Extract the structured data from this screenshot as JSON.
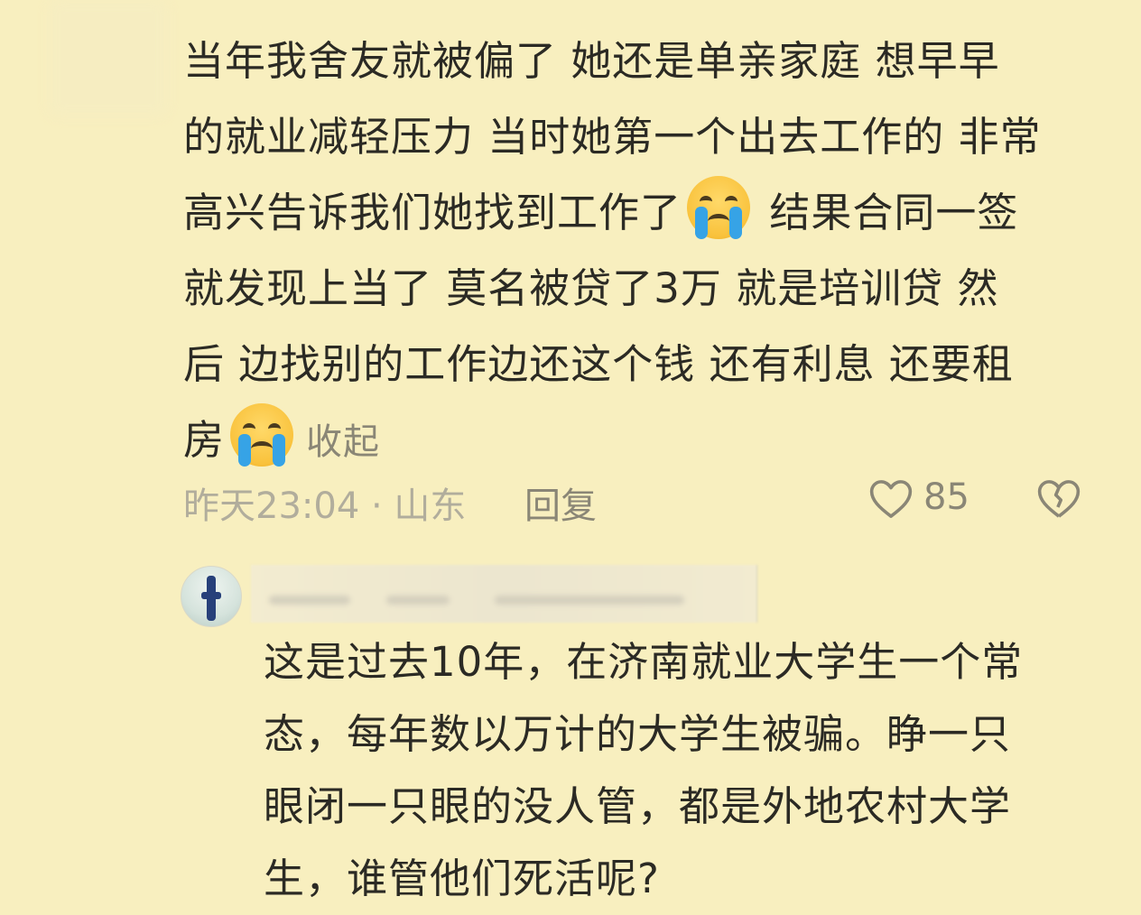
{
  "comment": {
    "lines": [
      "当年我舍友就被偏了  她还是单亲家庭 想早早",
      "的就业减轻压力 当时她第一个出去工作的 非常",
      "高兴告诉我们她找到工作了",
      " 结果合同一签",
      "就发现上当了 莫名被贷了3万 就是培训贷  然",
      "后  边找别的工作边还这个钱 还有利息 还要租",
      "房"
    ],
    "emoji_name": "loudly-crying-face",
    "collapse_label": "收起",
    "time_location": "昨天23:04 · 山东",
    "reply_label": "回复",
    "like_count": "85"
  },
  "reply": {
    "lines": [
      "这是过去10年，在济南就业大学生一个常",
      "态，每年数以万计的大学生被骗。睁一只",
      "眼闭一只眼的没人管，都是外地农村大学",
      "生，谁管他们死活呢?"
    ]
  },
  "colors": {
    "background": "#f8efbf",
    "text": "#2b2a24",
    "muted": "#8a8676"
  }
}
